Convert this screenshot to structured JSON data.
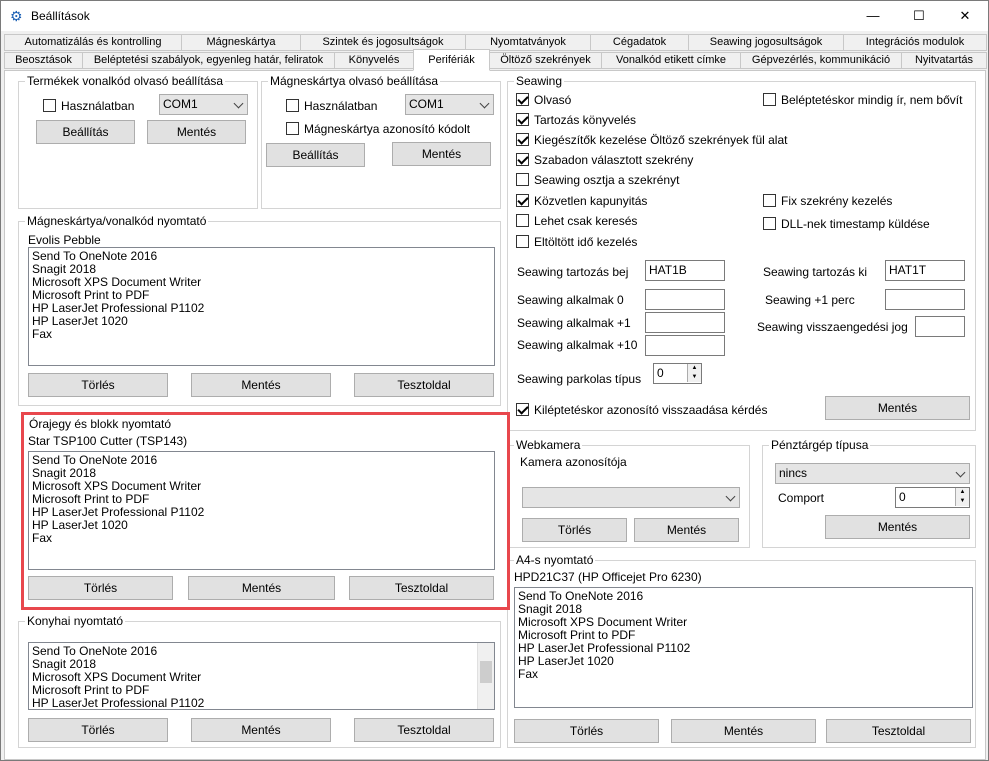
{
  "window": {
    "title": "Beállítások",
    "minimize": "—",
    "maximize": "☐",
    "close": "✕",
    "icon": "gear-settings-icon"
  },
  "tabs_row1": [
    "Automatizálás és kontrolling",
    "Mágneskártya",
    "Szintek és jogosultságok",
    "Nyomtatványok",
    "Cégadatok",
    "Seawing jogosultságok",
    "Integrációs modulok"
  ],
  "tabs_row2": [
    "Beosztások",
    "Beléptetési szabályok, egyenleg határ, feliratok",
    "Könyvelés",
    "Perifériák",
    "Öltöző szekrények",
    "Vonalkód etikett címke",
    "Gépvezérlés, kommunikáció",
    "Nyitvatartás"
  ],
  "barcode": {
    "title": "Termékek vonalkód olvasó beállítása",
    "use_label": "Használatban",
    "port": "COM1",
    "settings_btn": "Beállítás",
    "save_btn": "Mentés"
  },
  "magcard": {
    "title": "Mágneskártya olvasó beállítása",
    "use_label": "Használatban",
    "port": "COM1",
    "id_label": "Mágneskártya azonosító kódolt",
    "settings_btn": "Beállítás",
    "save_btn": "Mentés"
  },
  "printer_list": [
    "Send To OneNote 2016",
    "Snagit 2018",
    "Microsoft XPS Document Writer",
    "Microsoft Print to PDF",
    "HP LaserJet Professional P1102",
    "HP LaserJet 1020",
    "Fax"
  ],
  "mag_printer": {
    "title": "Mágneskártya/vonalkód nyomtató",
    "selected": "Evolis Pebble",
    "delete_btn": "Törlés",
    "save_btn": "Mentés",
    "test_btn": "Tesztoldal"
  },
  "receipt_printer": {
    "title": "Órajegy és blokk nyomtató",
    "selected": "Star TSP100 Cutter (TSP143)",
    "delete_btn": "Törlés",
    "save_btn": "Mentés",
    "test_btn": "Tesztoldal"
  },
  "kitchen_printer": {
    "title": "Konyhai nyomtató",
    "items": [
      "Send To OneNote 2016",
      "Snagit 2018",
      "Microsoft XPS Document Writer",
      "Microsoft Print to PDF",
      "HP LaserJet Professional P1102"
    ],
    "delete_btn": "Törlés",
    "save_btn": "Mentés",
    "test_btn": "Tesztoldal"
  },
  "seawing": {
    "title": "Seawing",
    "cb_olvaso": "Olvasó",
    "cb_tartozas": "Tartozás könyvelés",
    "cb_kiegeszitok": "Kiegészítők kezelése Öltöző szekrények fül alat",
    "cb_szabadon": "Szabadon választott szekrény",
    "cb_osztja": "Seawing osztja a szekrényt",
    "cb_kozvetlen": "Közvetlen kapunyitás",
    "cb_csak": "Lehet csak keresés",
    "cb_eltoltott": "Eltöltött idő kezelés",
    "cb_belepteto": "Beléptetéskor mindig ír, nem bővít",
    "cb_fix": "Fix szekrény kezelés",
    "cb_dll": "DLL-nek timestamp küldése",
    "lbl_tartozas_bej": "Seawing tartozás bej",
    "val_tartozas_bej": "HAT1B",
    "lbl_tartozas_ki": "Seawing tartozás ki",
    "val_tartozas_ki": "HAT1T",
    "lbl_alkalmak0": "Seawing alkalmak 0",
    "lbl_alkalmak1": "Seawing alkalmak +1",
    "lbl_alkalmak10": "Seawing alkalmak +10",
    "lbl_plus1perc": "Seawing +1 perc",
    "lbl_visszaeng": "Seawing visszaengedési jog",
    "lbl_parkolas": "Seawing parkolas típus",
    "val_parkolas": "0",
    "cb_kilepteto": "Kiléptetéskor azonosító visszaadása kérdés",
    "save_btn": "Mentés"
  },
  "webcam": {
    "title": "Webkamera",
    "id_label": "Kamera azonosítója",
    "delete_btn": "Törlés",
    "save_btn": "Mentés"
  },
  "cashreg": {
    "title": "Pénztárgép típusa",
    "type": "nincs",
    "port_label": "Comport",
    "port": "0",
    "save_btn": "Mentés"
  },
  "a4": {
    "title": "A4-s nyomtató",
    "selected": "HPD21C37 (HP Officejet Pro 6230)",
    "delete_btn": "Törlés",
    "save_btn": "Mentés",
    "test_btn": "Tesztoldal"
  }
}
